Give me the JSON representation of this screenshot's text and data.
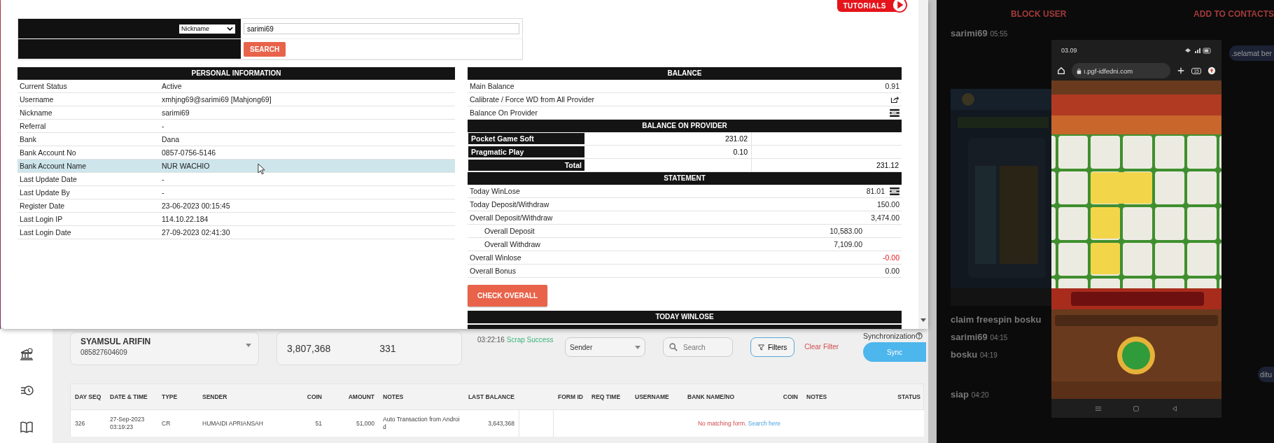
{
  "modal": {
    "logo": "TUTORIALS",
    "search": {
      "filter": "Nickname",
      "value": "sarimi69",
      "button": "SEARCH"
    },
    "personal": {
      "title": "PERSONAL INFORMATION",
      "rows": [
        {
          "label": "Current Status",
          "value": "Active",
          "selected": false
        },
        {
          "label": "Username",
          "value": "xmhjng69@sarimi69  [Mahjong69]",
          "selected": false
        },
        {
          "label": "Nickname",
          "value": "sarimi69",
          "selected": false
        },
        {
          "label": "Referral",
          "value": "-",
          "selected": false
        },
        {
          "label": "Bank",
          "value": "Dana",
          "selected": false
        },
        {
          "label": "Bank Account No",
          "value": "0857-0756-5146",
          "selected": false
        },
        {
          "label": "Bank Account Name",
          "value": "NUR WACHIO",
          "selected": true
        },
        {
          "label": "Last Update Date",
          "value": "-",
          "selected": false
        },
        {
          "label": "Last Update By",
          "value": "-",
          "selected": false
        },
        {
          "label": "Register Date",
          "value": "23-06-2023 00:15:45",
          "selected": false
        },
        {
          "label": "Last Login IP",
          "value": "114.10.22.184",
          "selected": false
        },
        {
          "label": "Last Login Date",
          "value": "27-09-2023 02:41:30",
          "selected": false
        }
      ]
    },
    "balance": {
      "title": "BALANCE",
      "rows": [
        {
          "label": "Main Balance",
          "value": "0.91",
          "kind": "plain"
        },
        {
          "label": "Calibrate / Force WD from All Provider",
          "kind": "action"
        },
        {
          "label": "Balance On Provider",
          "kind": "expand"
        }
      ]
    },
    "provider": {
      "title": "BALANCE ON PROVIDER",
      "rows": [
        {
          "name": "Pocket Game Soft",
          "value": "231.02"
        },
        {
          "name": "Pragmatic Play",
          "value": "0.10"
        }
      ],
      "total": {
        "label": "Total",
        "value": "231.12"
      }
    },
    "statement": {
      "title": "STATEMENT",
      "rows": [
        {
          "label": "Today WinLose",
          "value": "81.01",
          "kind": "expand",
          "negative": false
        },
        {
          "label": "Today Deposit/Withdraw",
          "value": "150.00",
          "kind": "plain",
          "negative": false
        },
        {
          "label": "Overall Deposit/Withdraw",
          "value": "3,474.00",
          "kind": "plain",
          "negative": false,
          "children": [
            {
              "label": "Overall Deposit",
              "value": "10,583.00",
              "negative": false
            },
            {
              "label": "Overall Withdraw",
              "value": "7,109.00",
              "negative": false
            }
          ]
        },
        {
          "label": "Overall Winlose",
          "value": "-0.00",
          "kind": "plain",
          "negative": true
        },
        {
          "label": "Overall Bonus",
          "value": "0.00",
          "kind": "plain",
          "negative": false
        }
      ]
    },
    "check_button": "CHECK OVERALL",
    "today_title": "TODAY WINLOSE"
  },
  "app": {
    "account": {
      "name": "SYAMSUL ARIFIN",
      "phone": "085827604609"
    },
    "stats": [
      "3,807,368",
      "331"
    ],
    "status": {
      "time": "03:22:16",
      "message": "Scrap Success"
    },
    "search_by": "Sender",
    "search_placeholder": "Search",
    "filters": "Filters",
    "clear_filter": "Clear Filter",
    "sync_label": "Synchronization",
    "sync": "Sync",
    "table": {
      "transaction_columns": [
        "DAY SEQ",
        "DATE & TIME",
        "TYPE",
        "SENDER",
        "COIN",
        "AMOUNT",
        "NOTES",
        "LAST BALANCE"
      ],
      "form_columns": [
        "FORM ID",
        "REQ TIME",
        "USERNAME",
        "BANK NAME/NO",
        "COIN",
        "NOTES",
        "STATUS"
      ],
      "rows": [
        {
          "cells": [
            "326",
            "27-Sep-2023 03:19:23",
            "CR",
            "HUMAIDI APRIANSAH",
            "51",
            "51,000",
            "Auto Transaction from Android",
            "3,643,368"
          ],
          "form_message": "No matching form.",
          "form_link": "Search here"
        }
      ]
    }
  },
  "chat": {
    "actions": [
      "BLOCK USER",
      "ADD TO CONTACTS"
    ],
    "messages": [
      {
        "kind": "incoming",
        "text": "sarimi69",
        "time": "05:55"
      },
      {
        "kind": "outgoing",
        "text": ".selamat ber"
      },
      {
        "kind": "picture"
      },
      {
        "kind": "incoming",
        "text": "claim freespin bosku"
      },
      {
        "kind": "incoming",
        "text": "sarimi69",
        "time": "04:15"
      },
      {
        "kind": "incoming",
        "text": "bosku",
        "time": "04:19"
      },
      {
        "kind": "outgoing",
        "text": "ditu"
      },
      {
        "kind": "incoming",
        "text": "siap",
        "time": "04:20"
      }
    ]
  },
  "phone": {
    "time": "03.09",
    "url": "ı.pgf-idfedni.com",
    "tab_count": "15"
  }
}
